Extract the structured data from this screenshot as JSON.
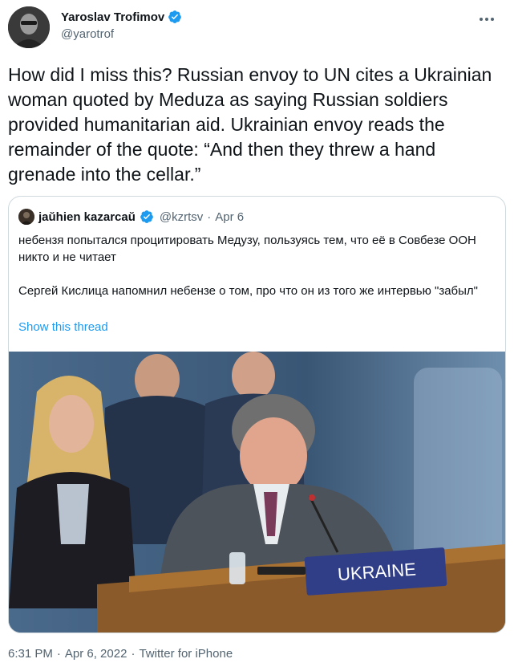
{
  "author": {
    "name": "Yaroslav Trofimov",
    "handle": "@yarotrof"
  },
  "tweet": {
    "text": "How did I miss this? Russian envoy to UN cites a Ukrainian woman quoted by Meduza as saying Russian soldiers provided humanitarian aid. Ukrainian envoy reads the remainder of the quote: “And then they threw a hand grenade into the cellar.”"
  },
  "quoted": {
    "name": "jaŭhien kazarcaŭ",
    "handle": "@kzrtsv",
    "separator": "·",
    "date": "Apr 6",
    "text": "небензя попытался процитировать Медузу, пользуясь тем, что её в Совбезе ООН никто и не читает\n\nСергей Кислица напомнил небензе о том, про что он из того же интервью \"забыл\"",
    "show_thread": "Show this thread",
    "media": {
      "nameplate": "UKRAINE"
    }
  },
  "meta": {
    "time": "6:31 PM",
    "separator1": "·",
    "date": "Apr 6, 2022",
    "separator2": "·",
    "source": "Twitter for iPhone"
  },
  "colors": {
    "link": "#1d9bf0",
    "verified": "#1d9bf0",
    "secondary_text": "#536471",
    "border": "#cfd9de"
  }
}
